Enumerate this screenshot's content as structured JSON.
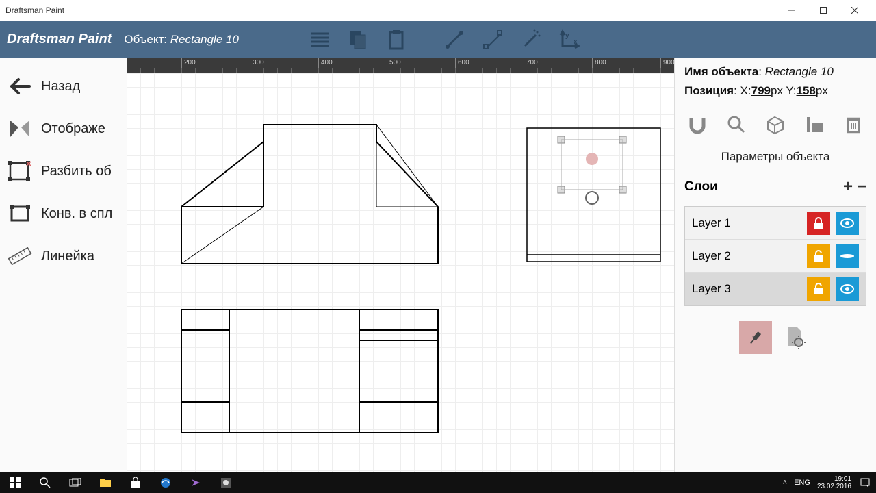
{
  "window": {
    "title": "Draftsman Paint"
  },
  "appbar": {
    "title": "Draftsman Paint",
    "object_label": "Объект:",
    "object_name": "Rectangle 10"
  },
  "sidebar": {
    "items": [
      {
        "label": "Назад"
      },
      {
        "label": "Отображе"
      },
      {
        "label": "Разбить об"
      },
      {
        "label": "Конв. в спл"
      },
      {
        "label": "Линейка"
      }
    ]
  },
  "ruler": {
    "majors": [
      "200",
      "300",
      "400",
      "500",
      "600",
      "700",
      "800",
      "900"
    ]
  },
  "right": {
    "obj_name_label": "Имя объекта",
    "obj_name_value": "Rectangle 10",
    "pos_label": "Позиция",
    "pos_x": "799",
    "pos_y": "158",
    "px": "px",
    "params_title": "Параметры объекта",
    "layers_title": "Слои",
    "layers": [
      {
        "name": "Layer 1",
        "locked": true,
        "visible": true
      },
      {
        "name": "Layer 2",
        "locked": false,
        "visible": "flat"
      },
      {
        "name": "Layer 3",
        "locked": false,
        "visible": true
      }
    ]
  },
  "taskbar": {
    "lang": "ENG",
    "time": "19:01",
    "date": "23.02.2016"
  }
}
